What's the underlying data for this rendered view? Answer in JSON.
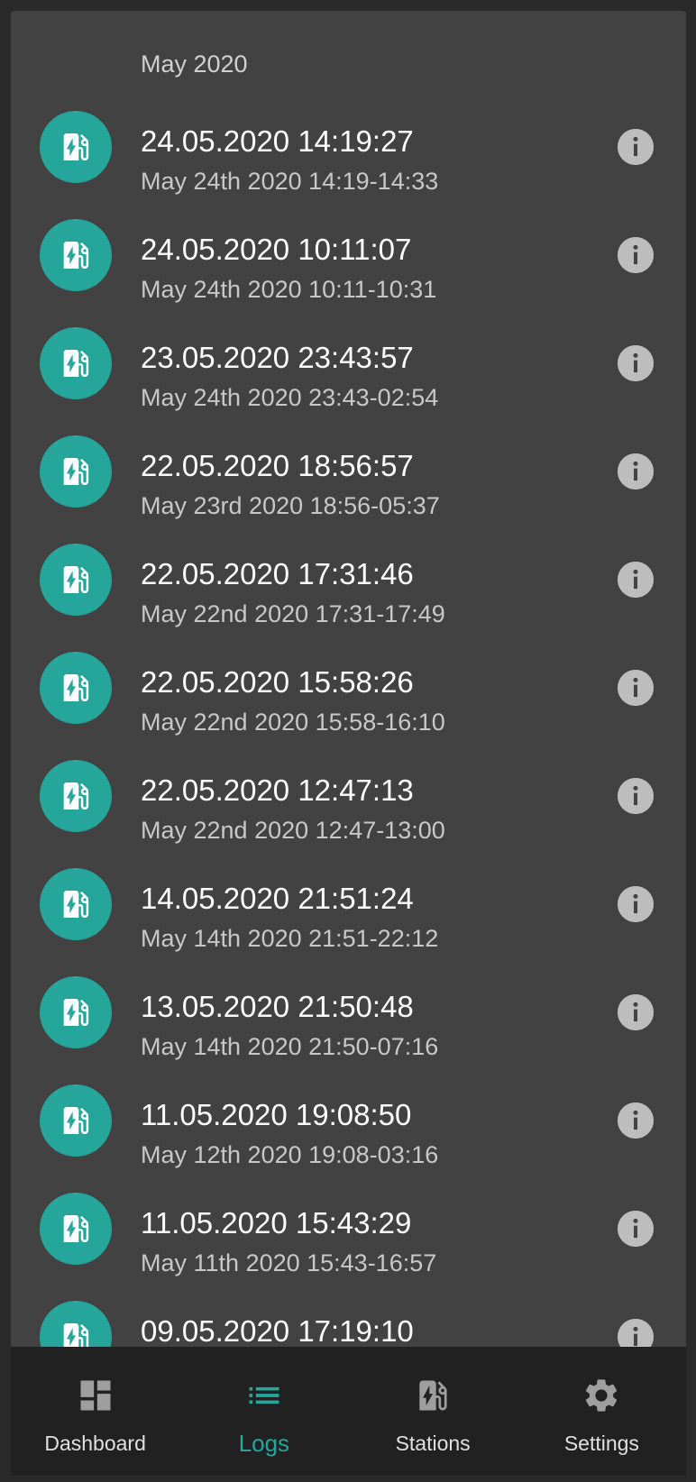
{
  "logs": {
    "section_header": "May 2020",
    "entries": [
      {
        "title": "24.05.2020 14:19:27",
        "subtitle": "May 24th 2020 14:19-14:33"
      },
      {
        "title": "24.05.2020 10:11:07",
        "subtitle": "May 24th 2020 10:11-10:31"
      },
      {
        "title": "23.05.2020 23:43:57",
        "subtitle": "May 24th 2020 23:43-02:54"
      },
      {
        "title": "22.05.2020 18:56:57",
        "subtitle": "May 23rd 2020 18:56-05:37"
      },
      {
        "title": "22.05.2020 17:31:46",
        "subtitle": "May 22nd 2020 17:31-17:49"
      },
      {
        "title": "22.05.2020 15:58:26",
        "subtitle": "May 22nd 2020 15:58-16:10"
      },
      {
        "title": "22.05.2020 12:47:13",
        "subtitle": "May 22nd 2020 12:47-13:00"
      },
      {
        "title": "14.05.2020 21:51:24",
        "subtitle": "May 14th 2020 21:51-22:12"
      },
      {
        "title": "13.05.2020 21:50:48",
        "subtitle": "May 14th 2020 21:50-07:16"
      },
      {
        "title": "11.05.2020 19:08:50",
        "subtitle": "May 12th 2020 19:08-03:16"
      },
      {
        "title": "11.05.2020 15:43:29",
        "subtitle": "May 11th 2020 15:43-16:57"
      },
      {
        "title": "09.05.2020 17:19:10",
        "subtitle": ""
      }
    ],
    "entry_icon": "ev-station-icon",
    "action_icon": "info-icon"
  },
  "bottom_nav": {
    "items": [
      {
        "label": "Dashboard",
        "icon": "dashboard-icon",
        "active": false
      },
      {
        "label": "Logs",
        "icon": "list-icon",
        "active": true
      },
      {
        "label": "Stations",
        "icon": "ev-station-icon",
        "active": false
      },
      {
        "label": "Settings",
        "icon": "gear-icon",
        "active": false
      }
    ]
  },
  "colors": {
    "accent": "#26a69a",
    "card_background": "#424242",
    "page_background": "#2a2a2a",
    "nav_background": "#212121",
    "info_icon": "#bdbdbd"
  }
}
